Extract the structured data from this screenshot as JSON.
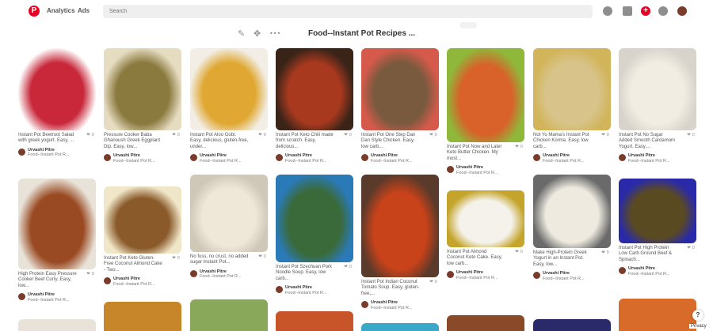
{
  "header": {
    "logo_glyph": "P",
    "nav": [
      "Analytics",
      "Ads"
    ],
    "search_placeholder": "Search",
    "add_glyph": "+"
  },
  "board": {
    "title": "Food--Instant Pot Recipes ...",
    "more_glyph": "•••"
  },
  "pins": [
    {
      "desc": "Instant Pot Beetroot Salad with greek yogurt. Easy, ...",
      "reacts": "0",
      "user": "Urvashi Pitre",
      "board": "Food--Instant Pot R...",
      "img_color": "#c8283a",
      "img_bg": "#ffffff"
    },
    {
      "desc": "Pressure Cooker Baba Ghanoush Greek Eggplant Dip. Easy, low...",
      "reacts": "0",
      "user": "Urvashi Pitre",
      "board": "Food--Instant Pot R...",
      "img_color": "#8a7a3e",
      "img_bg": "#e6dcc2"
    },
    {
      "desc": "Instant Pot Aloo Gobi. Easy, delicious, gluten-free, under...",
      "reacts": "0",
      "user": "Urvashi Pitre",
      "board": "Food--Instant Pot R...",
      "img_color": "#e0a832",
      "img_bg": "#f2eee6"
    },
    {
      "desc": "Instant Pot Keto Chili made from scratch. Easy, delicious...",
      "reacts": "0",
      "user": "Urvashi Pitre",
      "board": "Food--Instant Pot R...",
      "img_color": "#a8391f",
      "img_bg": "#3a2418"
    },
    {
      "desc": "Instant Pot One Step Dan Dan Style Chicken. Easy, low carb...",
      "reacts": "0",
      "user": "Urvashi Pitre",
      "board": "Food--Instant Pot R...",
      "img_color": "#7a5a3e",
      "img_bg": "#d65a4c"
    },
    {
      "desc": "Instant Pot Now and Later Keto Butter Chicken. My most...",
      "reacts": "0",
      "user": "Urvashi Pitre",
      "board": "Food--Instant Pot R...",
      "img_color": "#d8622a",
      "img_bg": "#8fb83a"
    },
    {
      "desc": "Not Yo Mama's Instant Pot Chicken Korma. Easy, low carb...",
      "reacts": "0",
      "user": "Urvashi Pitre",
      "board": "Food--Instant Pot R...",
      "img_color": "#d8c48a",
      "img_bg": "#d2b45a"
    },
    {
      "desc": "Instant Pot No Sugar Added Smooth Cardamom Yogurt. Easy,...",
      "reacts": "0",
      "user": "Urvashi Pitre",
      "board": "Food--Instant Pot R...",
      "img_color": "#f2ede2",
      "img_bg": "#d8d4cc"
    },
    {
      "desc": "High Protein Easy Pressure Cooker Beef Curry. Easy, low...",
      "reacts": "0",
      "user": "Urvashi Pitre",
      "board": "Food--Instant Pot R...",
      "img_color": "#9a4a22",
      "img_bg": "#e8e2d8"
    },
    {
      "desc": "Instant Pot Keto Gluten-Free Coconut Almond Cake - Two...",
      "reacts": "0",
      "user": "Urvashi Pitre",
      "board": "Food--Instant Pot R...",
      "img_color": "#8a5a2a",
      "img_bg": "#f0e6c8"
    },
    {
      "desc": "No fuss, no crust, no added sugar Instant Pot...",
      "reacts": "0",
      "user": "Urvashi Pitre",
      "board": "Food--Instant Pot R...",
      "img_color": "#efe8d8",
      "img_bg": "#cfc8b8"
    },
    {
      "desc": "Instant Pot Szechuan Pork Noodle Soup. Easy, low carb...",
      "reacts": "0",
      "user": "Urvashi Pitre",
      "board": "Food--Instant Pot R...",
      "img_color": "#3a6a3a",
      "img_bg": "#2a7ab8"
    },
    {
      "desc": "Instant Pot Indian Coconut Tomato Soup. Easy, gluten-free,...",
      "reacts": "0",
      "user": "Urvashi Pitre",
      "board": "Food--Instant Pot R...",
      "img_color": "#c8421a",
      "img_bg": "#5a3a2a"
    },
    {
      "desc": "Instant Pot Almond Coconut Keto Cake. Easy, low carb...",
      "reacts": "0",
      "user": "Urvashi Pitre",
      "board": "Food--Instant Pot R...",
      "img_color": "#f4f2ea",
      "img_bg": "#c4a42a"
    },
    {
      "desc": "Make High-Protein Greek Yogurt in an Instant Pot. Easy, low...",
      "reacts": "0",
      "user": "Urvashi Pitre",
      "board": "Food--Instant Pot R...",
      "img_color": "#eeeae0",
      "img_bg": "#6a6a6a"
    },
    {
      "desc": "Instant Pot High Protein Low Carb Ground Beef & Spinach...",
      "reacts": "0",
      "user": "Urvashi Pitre",
      "board": "Food--Instant Pot R...",
      "img_color": "#5a4a22",
      "img_bg": "#2a2aa8"
    }
  ],
  "bottom_row_colors": [
    "#e8e2d8",
    "#c8862a",
    "#8aa85a",
    "#c8542a",
    "#3aa8c8",
    "#8a4a2a",
    "#2a2a6a",
    "#d86a2a"
  ],
  "footer": {
    "help": "?",
    "privacy": "Privacy"
  }
}
